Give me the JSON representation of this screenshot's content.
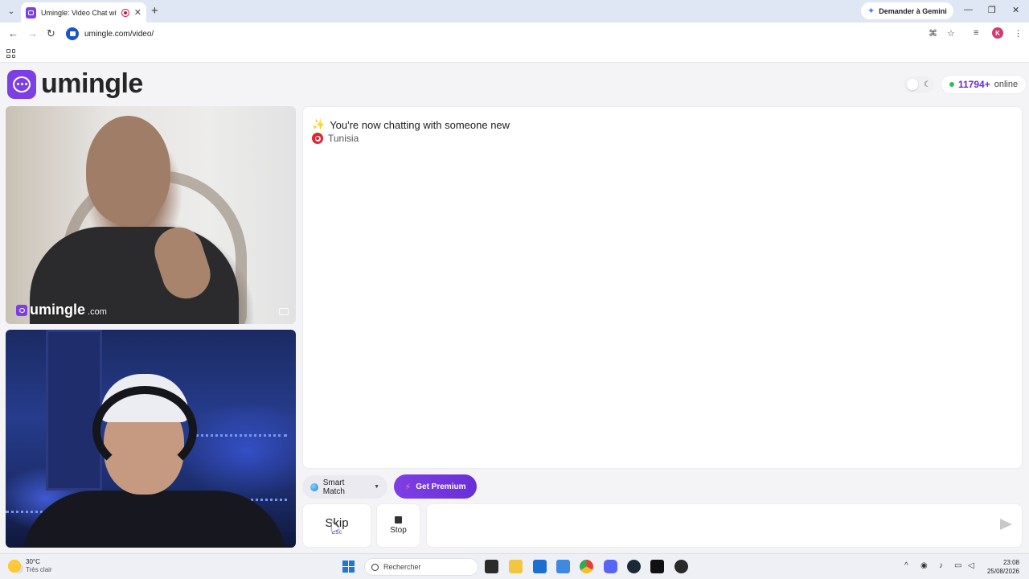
{
  "browser": {
    "tab_title": "Umingle: Video Chat with S",
    "gemini_label": "Demander à Gemini",
    "url": "umingle.com/video/",
    "profile_initial": "K"
  },
  "page": {
    "brand_name": "umingle",
    "online_count": "11794+",
    "online_label": "online",
    "watermark_name": "umingle",
    "watermark_tld": ".com"
  },
  "chat": {
    "system_message": "You're now chatting with someone new",
    "country": "Tunisia"
  },
  "controls": {
    "smart_match_label": "Smart Match",
    "premium_label": "Get Premium",
    "skip_label": "Skip",
    "skip_hint": "Esc",
    "stop_label": "Stop",
    "message_placeholder": ""
  },
  "taskbar": {
    "temperature": "30°C",
    "weather_condition": "Très clair",
    "search_placeholder": "Rechercher",
    "time": "23:08",
    "date": "25/08/2026"
  },
  "colors": {
    "brand": "#7b3fe4",
    "online_dot": "#2ec15a",
    "premium": "#6a2fd6"
  }
}
